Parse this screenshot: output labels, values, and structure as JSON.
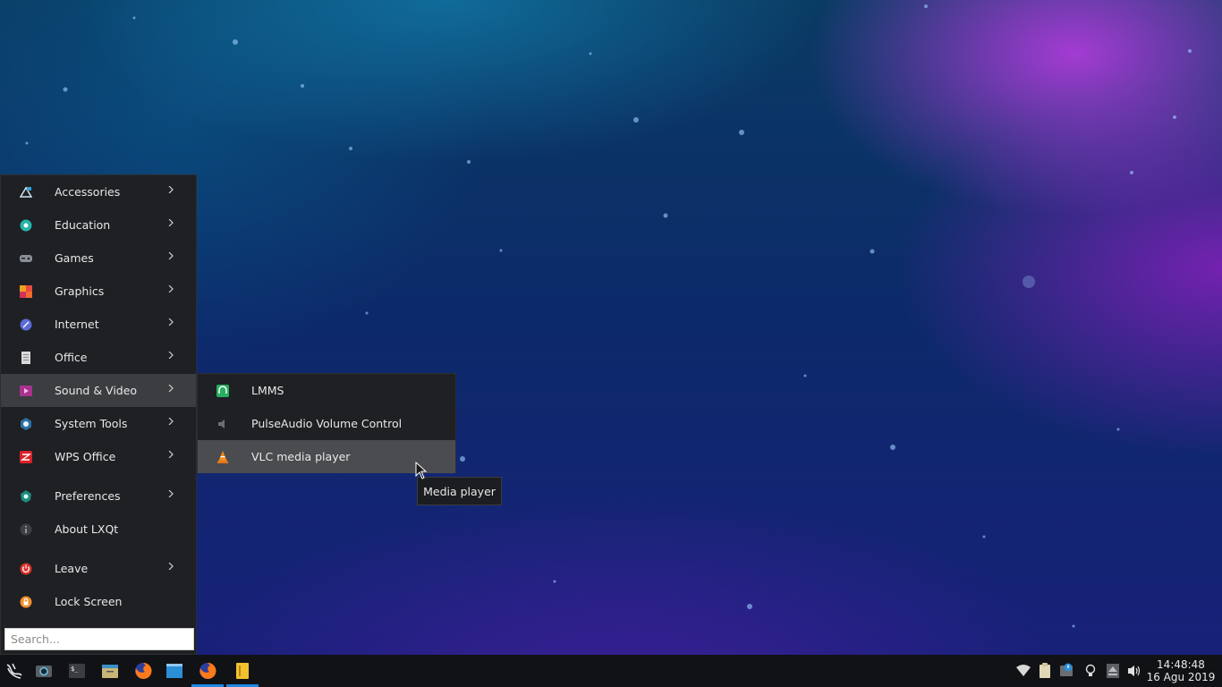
{
  "main_menu": {
    "items": [
      {
        "label": "Accessories",
        "icon": "accessories-icon"
      },
      {
        "label": "Education",
        "icon": "education-icon"
      },
      {
        "label": "Games",
        "icon": "games-icon"
      },
      {
        "label": "Graphics",
        "icon": "graphics-icon"
      },
      {
        "label": "Internet",
        "icon": "internet-icon"
      },
      {
        "label": "Office",
        "icon": "office-icon"
      },
      {
        "label": "Sound & Video",
        "icon": "sound-video-icon"
      },
      {
        "label": "System Tools",
        "icon": "system-tools-icon"
      },
      {
        "label": "WPS Office",
        "icon": "wps-office-icon"
      },
      {
        "label": "Preferences",
        "icon": "preferences-icon"
      },
      {
        "label": "About LXQt",
        "icon": "about-icon"
      },
      {
        "label": "Leave",
        "icon": "leave-icon"
      },
      {
        "label": "Lock Screen",
        "icon": "lock-icon"
      }
    ],
    "search_placeholder": "Search..."
  },
  "submenu": {
    "items": [
      {
        "label": "LMMS",
        "icon": "lmms-icon"
      },
      {
        "label": "PulseAudio Volume Control",
        "icon": "volume-icon"
      },
      {
        "label": "VLC media player",
        "icon": "vlc-icon"
      }
    ]
  },
  "tooltip": {
    "text": "Media player"
  },
  "clock": {
    "time": "14:48:48",
    "date": "16 Agu 2019"
  },
  "colors": {
    "accent": "#1e88e5",
    "menu_bg": "#1e2024",
    "active_bg": "#3b3d41"
  }
}
